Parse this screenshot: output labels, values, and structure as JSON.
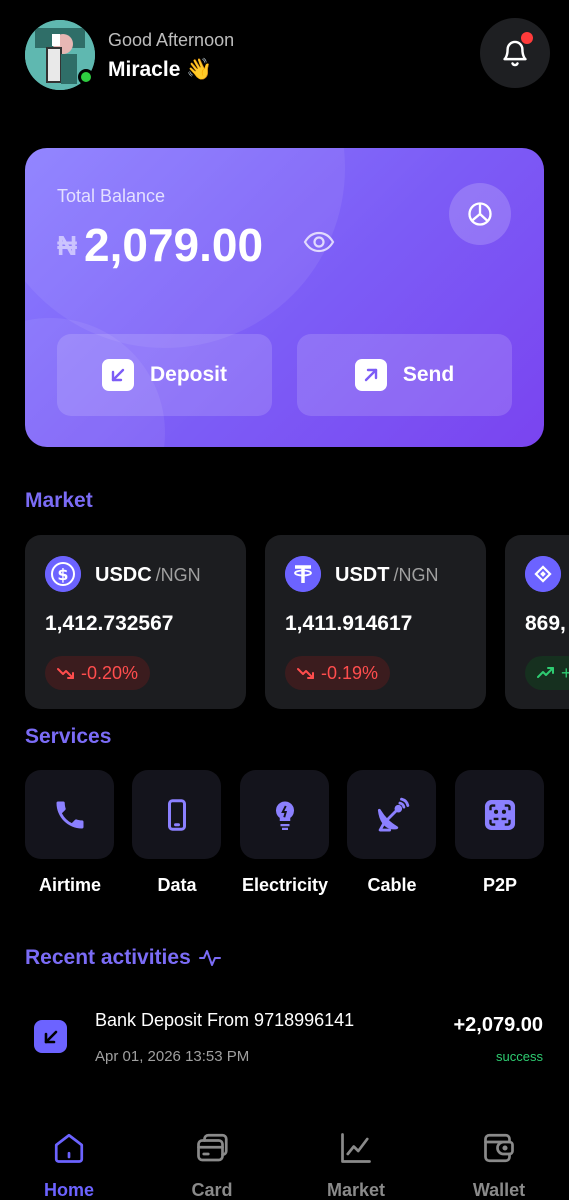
{
  "header": {
    "greeting": "Good Afternoon",
    "username": "Miracle 👋"
  },
  "balance": {
    "label": "Total Balance",
    "currency_symbol": "₦",
    "amount": "2,079.00",
    "deposit_label": "Deposit",
    "send_label": "Send"
  },
  "market": {
    "title": "Market",
    "items": [
      {
        "symbol": "USDC",
        "pair": "/NGN",
        "price": "1,412.732567",
        "change": "-0.20%",
        "direction": "down",
        "icon": "usdc-icon"
      },
      {
        "symbol": "USDT",
        "pair": "/NGN",
        "price": "1,411.914617",
        "change": "-0.19%",
        "direction": "down",
        "icon": "usdt-icon"
      },
      {
        "symbol": "",
        "pair": "",
        "price": "869,",
        "change": "+",
        "direction": "up",
        "icon": "bnb-icon"
      }
    ]
  },
  "services": {
    "title": "Services",
    "items": [
      {
        "label": "Airtime",
        "icon": "phone-icon"
      },
      {
        "label": "Data",
        "icon": "mobile-icon"
      },
      {
        "label": "Electricity",
        "icon": "bulb-icon"
      },
      {
        "label": "Cable",
        "icon": "satellite-dish-icon"
      },
      {
        "label": "P2P",
        "icon": "p2p-icon"
      }
    ]
  },
  "recent": {
    "title": "Recent activities",
    "items": [
      {
        "title": "Bank Deposit From 9718996141",
        "date": "Apr 01, 2026 13:53 PM",
        "amount": "+2,079.00",
        "status": "success"
      }
    ]
  },
  "nav": {
    "items": [
      {
        "label": "Home",
        "icon": "home-icon",
        "active": true
      },
      {
        "label": "Card",
        "icon": "card-icon",
        "active": false
      },
      {
        "label": "Market",
        "icon": "chart-icon",
        "active": false
      },
      {
        "label": "Wallet",
        "icon": "wallet-icon",
        "active": false
      }
    ]
  },
  "colors": {
    "accent": "#6c63ff",
    "negative": "#ff4d4d",
    "positive": "#2ecc71"
  }
}
